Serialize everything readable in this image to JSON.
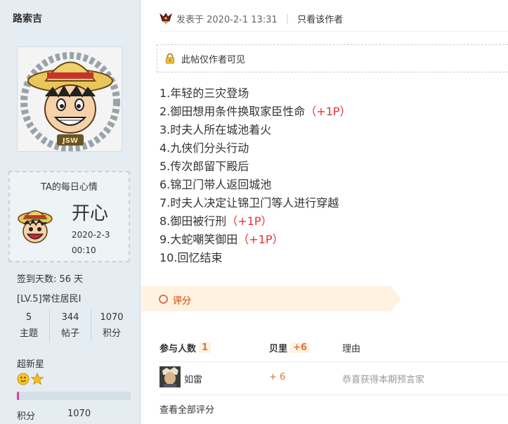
{
  "user": {
    "name": "路索吉",
    "mood": {
      "title": "TA的每日心情",
      "word": "开心",
      "date": "2020-2-3",
      "time": "00:10"
    },
    "sign_days": "签到天数: 56 天",
    "level": "[LV.5]常住居民I",
    "stats": [
      {
        "value": "5",
        "label": "主题"
      },
      {
        "value": "344",
        "label": "帖子"
      },
      {
        "value": "1070",
        "label": "积分"
      }
    ],
    "rank": "超新星",
    "medals": [
      "smiley-medal-icon",
      "star-medal-icon"
    ],
    "progress_fraction": 0.02,
    "credits_label": "积分",
    "credits_value": "1070"
  },
  "post": {
    "posted_at": "发表于 2020-2-1 13:31",
    "separator": "|",
    "author_only": "只看该作者",
    "notice": "此帖仅作者可见",
    "lines": [
      {
        "text": "1.年轻的三灾登场",
        "tag": ""
      },
      {
        "text": "2.御田想用条件换取家臣性命",
        "tag": "（+1P）"
      },
      {
        "text": "3.时夫人所在城池着火",
        "tag": ""
      },
      {
        "text": "4.九侠们分头行动",
        "tag": ""
      },
      {
        "text": "5.传次郎留下殿后",
        "tag": ""
      },
      {
        "text": "6.锦卫门带人返回城池",
        "tag": ""
      },
      {
        "text": "7.时夫人决定让锦卫门等人进行穿越",
        "tag": ""
      },
      {
        "text": "8.御田被行刑",
        "tag": "（+1P）"
      },
      {
        "text": "9.大蛇嘲笑御田",
        "tag": "（+1P）"
      },
      {
        "text": "10.回忆结束",
        "tag": ""
      }
    ]
  },
  "rating": {
    "title": "评分",
    "participants_label": "参与人数",
    "participants_count": "1",
    "shell_label": "贝里",
    "shell_total": "+6",
    "reason_label": "理由",
    "rows": [
      {
        "name": "如雷",
        "score": "+ 6",
        "reason": "恭喜获得本期预言家"
      }
    ],
    "view_all": "查看全部评分"
  },
  "colors": {
    "sidebar_bg": "#e5edf2",
    "accent_orange": "#e8703a",
    "tag_red": "#e53333",
    "progress_pink": "#e6409b"
  }
}
